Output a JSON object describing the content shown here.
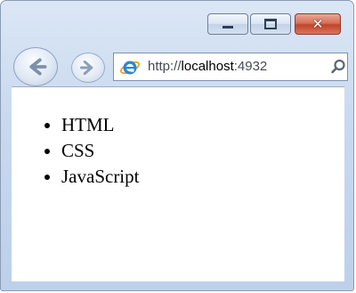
{
  "window": {
    "controls": {
      "minimize": "minimize",
      "maximize": "maximize",
      "close": "✕"
    }
  },
  "navigation": {
    "back_icon": "back-arrow-icon",
    "forward_icon": "forward-arrow-icon"
  },
  "address_bar": {
    "scheme": "http://",
    "host": "localhost",
    "port_partial": ":4932",
    "browser_icon": "ie-icon",
    "search_icon": "search-icon"
  },
  "page": {
    "list_items": [
      "HTML",
      "CSS",
      "JavaScript"
    ]
  },
  "colors": {
    "frame_top": "#dbe7f6",
    "frame_bottom": "#bcd0ea",
    "close_button": "#c2432a",
    "content_background": "#ffffff"
  }
}
